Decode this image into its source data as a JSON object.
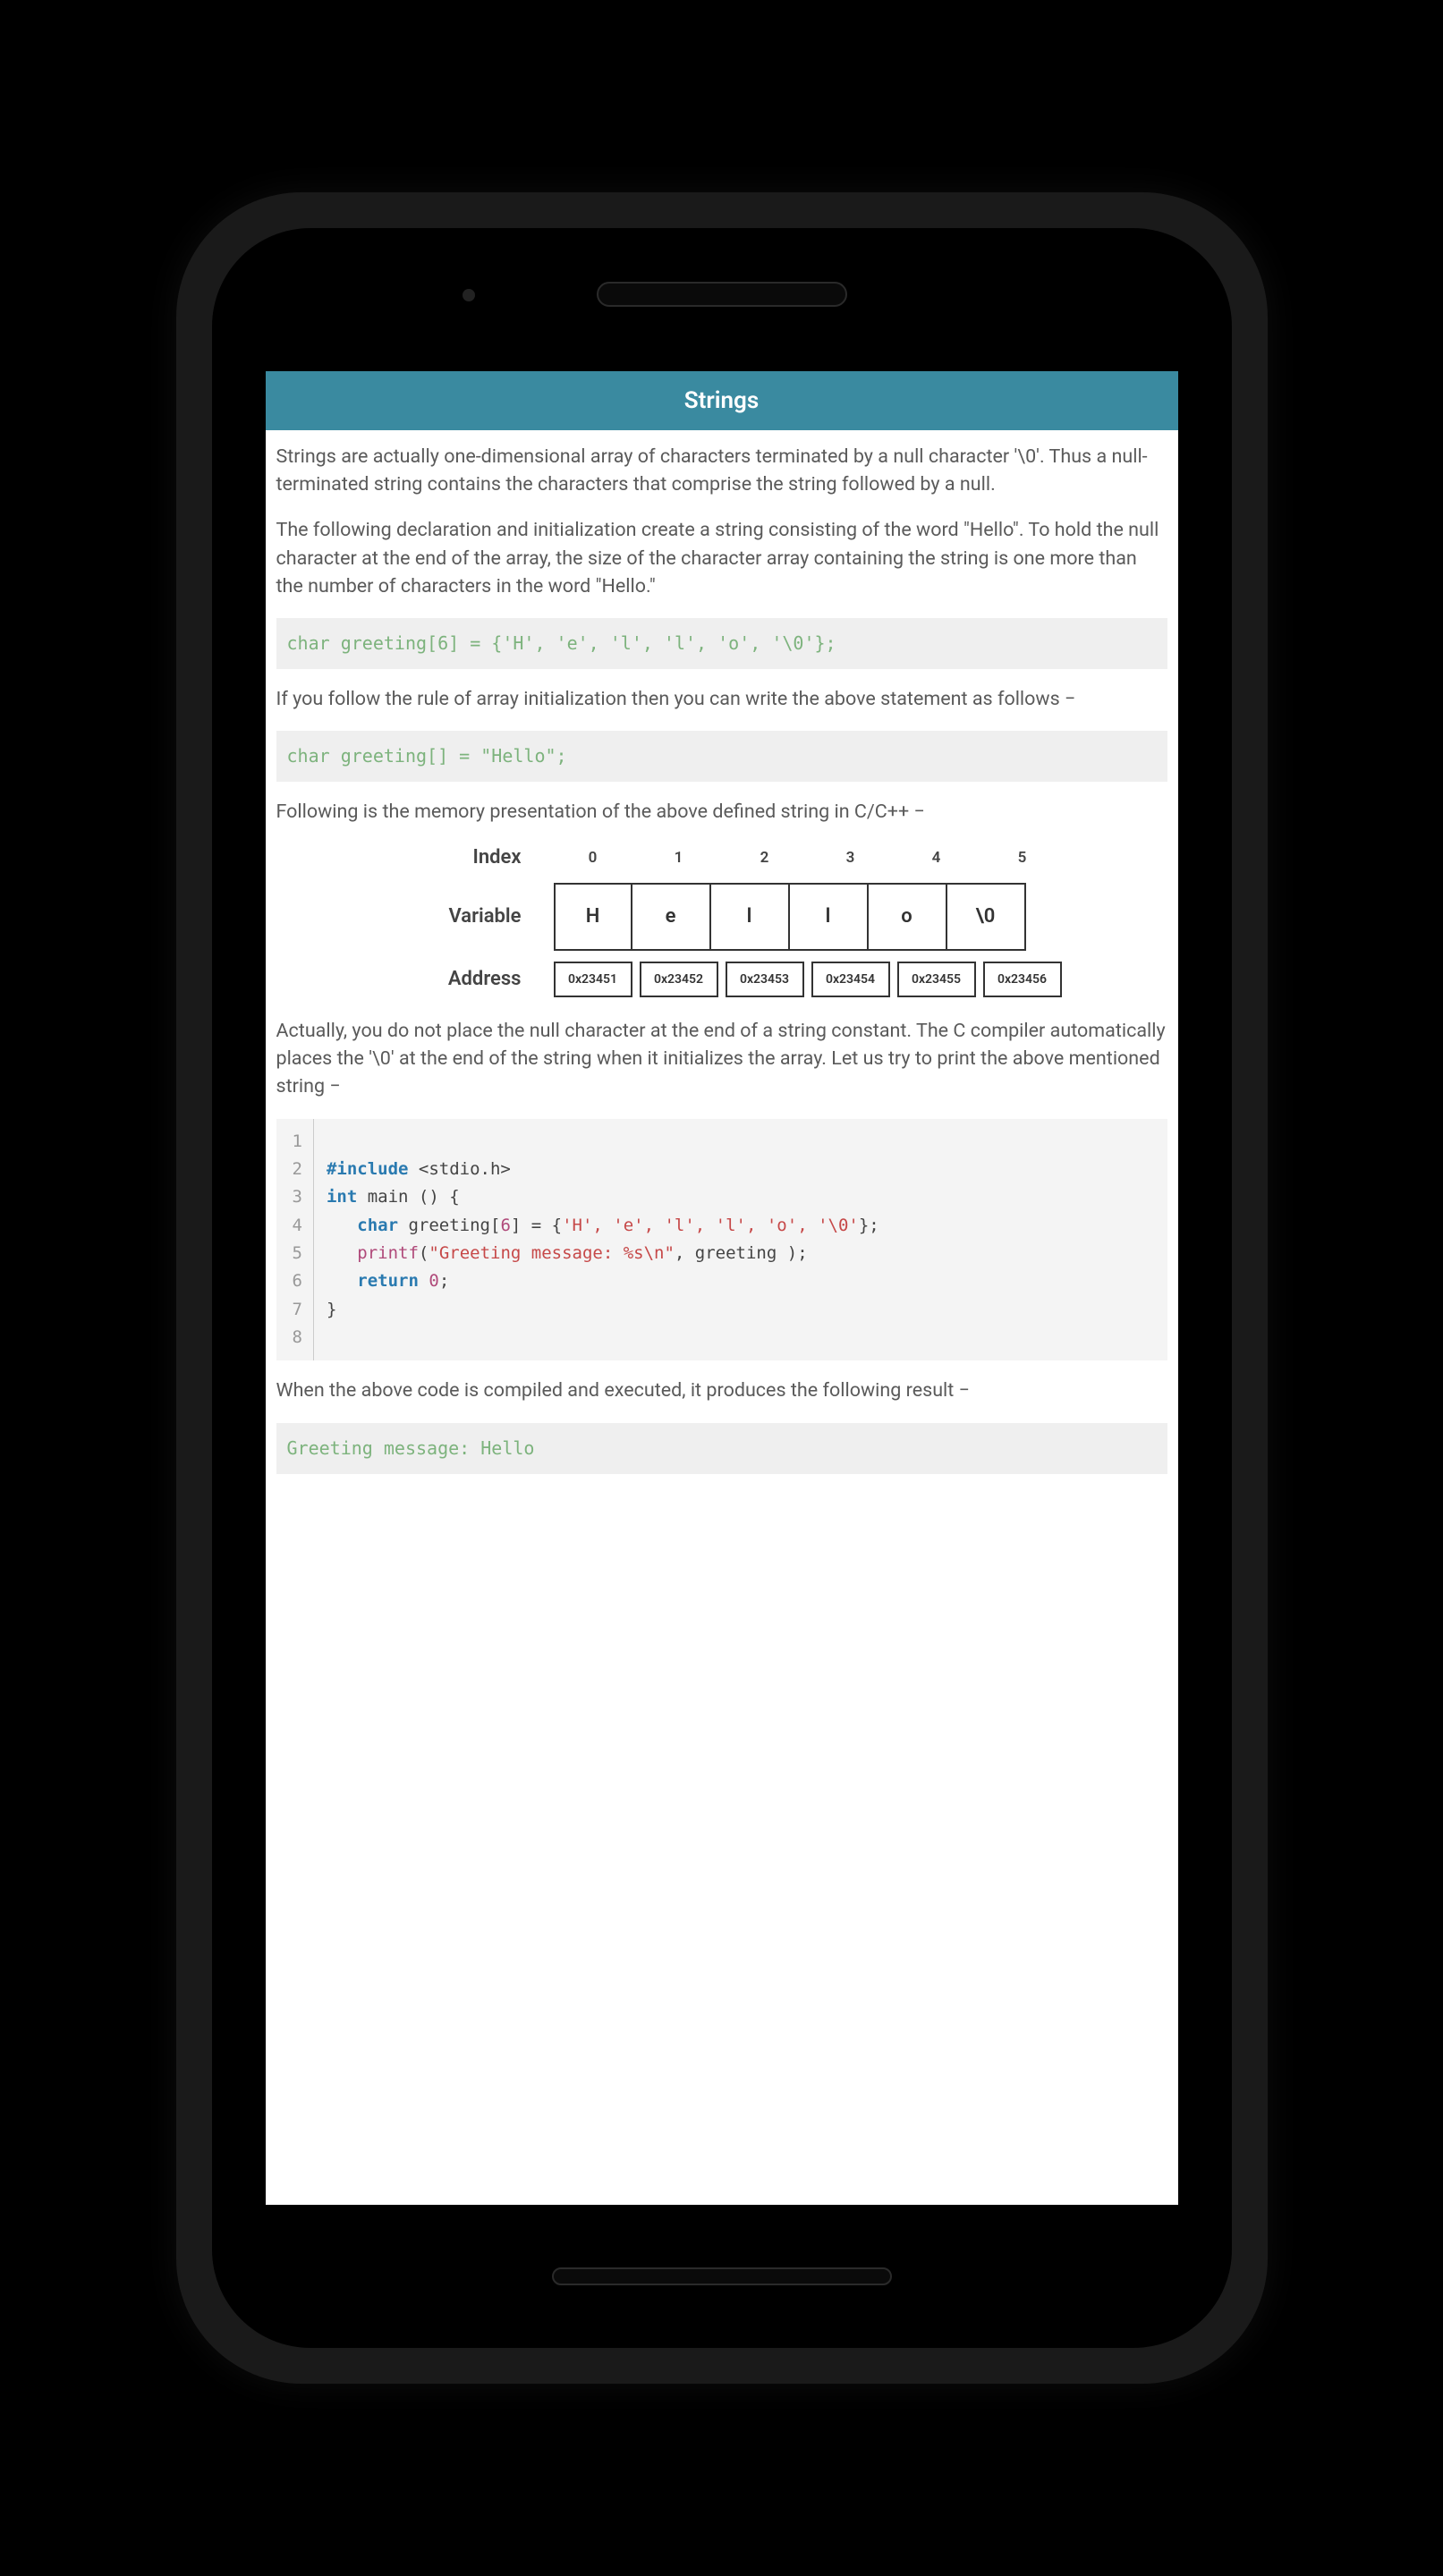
{
  "header": {
    "title": "Strings"
  },
  "paragraphs": {
    "p1": "Strings are actually one-dimensional array of characters terminated by a null character '\\0'. Thus a null-terminated string contains the characters that comprise the string followed by a null.",
    "p2": "The following declaration and initialization create a string consisting of the word \"Hello\". To hold the null character at the end of the array, the size of the character array containing the string is one more than the number of characters in the word \"Hello.\"",
    "p3": "If you follow the rule of array initialization then you can write the above statement as follows −",
    "p4": "Following is the memory presentation of the above defined string in C/C++ −",
    "p5": "Actually, you do not place the null character at the end of a string constant. The C compiler automatically places the '\\0' at the end of the string when it initializes the array. Let us try to print the above mentioned string −",
    "p6": "When the above code is compiled and executed, it produces the following result −"
  },
  "code_snippets": {
    "decl1": "char greeting[6] = {'H', 'e', 'l', 'l', 'o', '\\0'};",
    "decl2": "char greeting[] = \"Hello\";"
  },
  "memory_diagram": {
    "labels": {
      "index": "Index",
      "variable": "Variable",
      "address": "Address"
    },
    "indices": [
      "0",
      "1",
      "2",
      "3",
      "4",
      "5"
    ],
    "variable": [
      "H",
      "e",
      "l",
      "l",
      "o",
      "\\0"
    ],
    "address": [
      "0x23451",
      "0x23452",
      "0x23453",
      "0x23454",
      "0x23455",
      "0x23456"
    ]
  },
  "code_block": {
    "lines": [
      "1",
      "2",
      "3",
      "4",
      "5",
      "6",
      "7",
      "8"
    ],
    "src": {
      "l1": "",
      "l2_include": "#include",
      "l2_rest": " <stdio.h>",
      "l3_int": "int",
      "l3_rest": " main () {",
      "l4_char": "char",
      "l4_mid": " greeting[",
      "l4_six": "6",
      "l4_after": "] = {",
      "l4_chars": "'H', 'e', 'l', 'l', 'o', '\\0'",
      "l4_end": "};",
      "l5_fn": "printf",
      "l5_open": "(",
      "l5_str": "\"Greeting message: %s\\n\"",
      "l5_rest": ", greeting );",
      "l6_ret": "return",
      "l6_sp": " ",
      "l6_zero": "0",
      "l6_semi": ";",
      "l7": "}",
      "l8": ""
    }
  },
  "output": {
    "text": "Greeting message: Hello"
  }
}
